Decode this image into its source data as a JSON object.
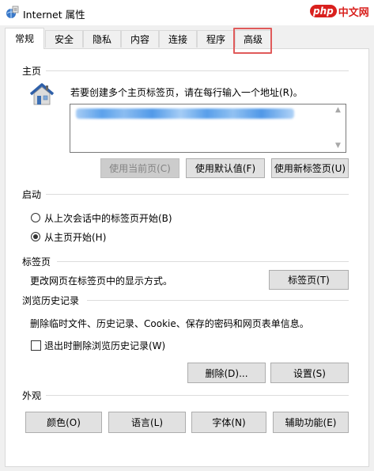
{
  "window": {
    "title": "Internet 属性",
    "watermark": {
      "badge": "php",
      "text": "中文网"
    }
  },
  "tabs": [
    {
      "label": "常规",
      "active": true
    },
    {
      "label": "安全"
    },
    {
      "label": "隐私"
    },
    {
      "label": "内容"
    },
    {
      "label": "连接"
    },
    {
      "label": "程序"
    },
    {
      "label": "高级",
      "highlighted": true
    }
  ],
  "home": {
    "section_label": "主页",
    "hint": "若要创建多个主页标签页，请在每行输入一个地址(R)。",
    "buttons": {
      "use_current": "使用当前页(C)",
      "use_default": "使用默认值(F)",
      "use_new_tab": "使用新标签页(U)"
    }
  },
  "startup": {
    "section_label": "启动",
    "options": [
      {
        "label": "从上次会话中的标签页开始(B)",
        "checked": false
      },
      {
        "label": "从主页开始(H)",
        "checked": true
      }
    ]
  },
  "tabs_section": {
    "section_label": "标签页",
    "description": "更改网页在标签页中的显示方式。",
    "button": "标签页(T)"
  },
  "history": {
    "section_label": "浏览历史记录",
    "description": "删除临时文件、历史记录、Cookie、保存的密码和网页表单信息。",
    "checkbox_label": "退出时删除浏览历史记录(W)",
    "checkbox_checked": false,
    "delete_button": "删除(D)...",
    "settings_button": "设置(S)"
  },
  "appearance": {
    "section_label": "外观",
    "buttons": [
      "颜色(O)",
      "语言(L)",
      "字体(N)",
      "辅助功能(E)"
    ]
  },
  "colors": {
    "highlight_border": "#e05a5a",
    "watermark_red": "#d9201d"
  }
}
